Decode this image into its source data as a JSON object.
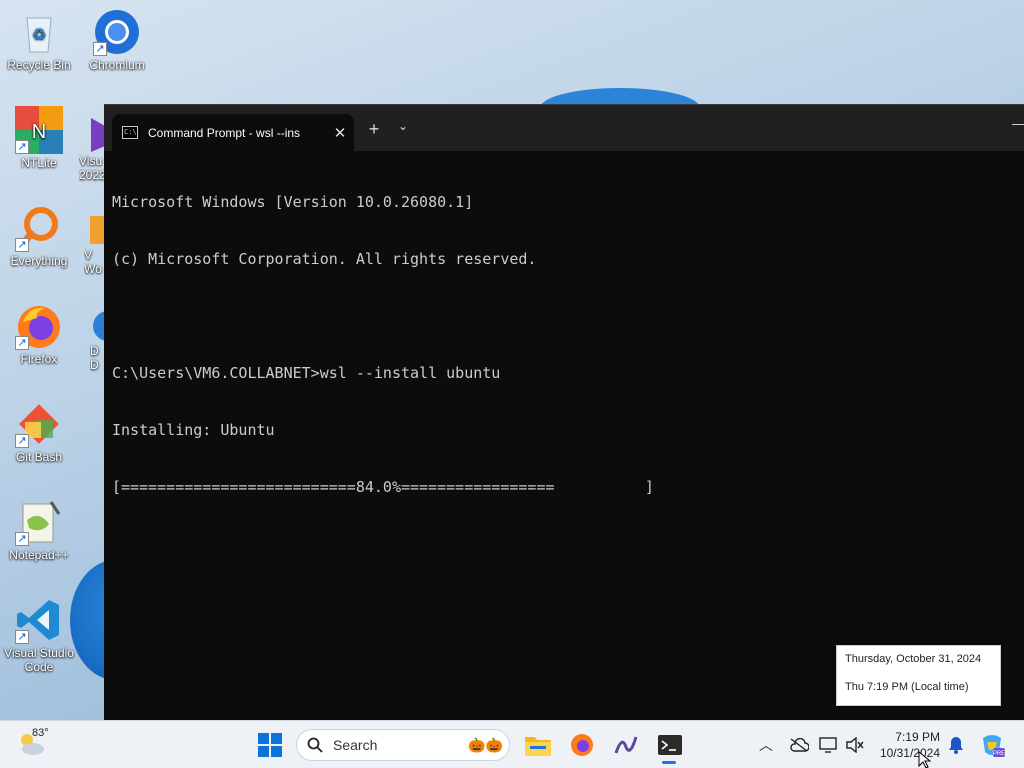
{
  "desktop": {
    "icons": [
      {
        "label": "Recycle Bin"
      },
      {
        "label": "Chromium"
      },
      {
        "label": "NTLite"
      },
      {
        "label": "Visu\n2022"
      },
      {
        "label": "Everything"
      },
      {
        "label": "V\nWo"
      },
      {
        "label": "Firefox"
      },
      {
        "label": "D\nD"
      },
      {
        "label": "Git Bash"
      },
      {
        "label": "Notepad++"
      },
      {
        "label": "Visual Studio Code"
      }
    ]
  },
  "terminal": {
    "tab_title": "Command Prompt - wsl  --ins",
    "tab_close": "✕",
    "new_tab": "+",
    "tab_menu": "⌄",
    "minimize": "—",
    "lines": [
      "Microsoft Windows [Version 10.0.26080.1]",
      "(c) Microsoft Corporation. All rights reserved.",
      "",
      "C:\\Users\\VM6.COLLABNET>wsl --install ubuntu",
      "Installing: Ubuntu",
      "[==========================84.0%=================          ]"
    ],
    "progress_percent": 84.0
  },
  "tooltip": {
    "date": "Thursday, October 31, 2024",
    "time": "Thu 7:19 PM (Local time)"
  },
  "taskbar": {
    "weather_temp": "83°",
    "search_placeholder": "Search",
    "clock_time": "7:19 PM",
    "clock_date": "10/31/2024",
    "accent": "#1a73e8"
  }
}
